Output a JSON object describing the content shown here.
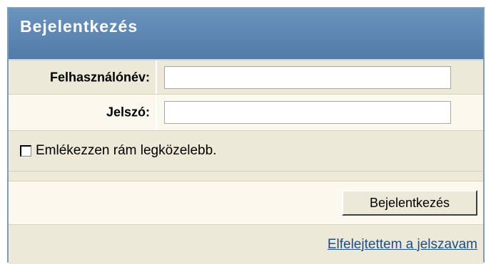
{
  "login": {
    "title": "Bejelentkezés",
    "username_label": "Felhasználónév:",
    "username_value": "",
    "password_label": "Jelszó:",
    "password_value": "",
    "remember_label": "Emlékezzen rám legközelebb.",
    "remember_checked": false,
    "submit_label": "Bejelentkezés",
    "forgot_link": "Elfelejtettem a jelszavam"
  },
  "colors": {
    "header_bg": "#5e88b4",
    "row_alt": "#fbf8ee",
    "row_base": "#ece9d8",
    "link": "#1f4e85"
  }
}
